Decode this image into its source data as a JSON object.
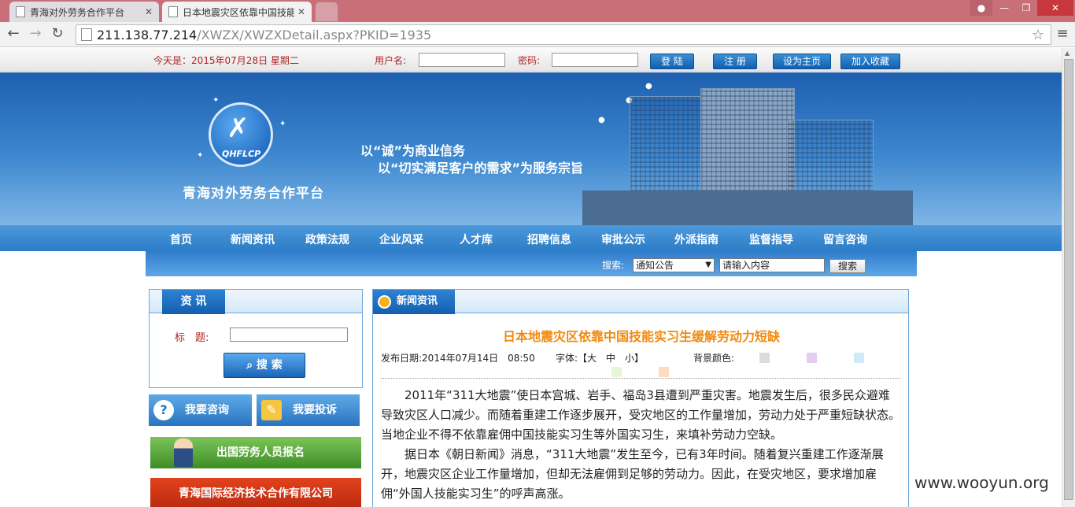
{
  "browser": {
    "tabs": [
      {
        "title": "青海对外劳务合作平台"
      },
      {
        "title": "日本地震灾区依靠中国技能"
      }
    ],
    "url_host": "211.138.77.214",
    "url_path": "/XWZX/XWZXDetail.aspx?PKID=1935"
  },
  "topbar": {
    "date": "今天是：2015年07月28日 星期二",
    "username_label": "用户名:",
    "password_label": "密码:",
    "login": "登 陆",
    "register": "注 册",
    "set_home": "设为主页",
    "favorite": "加入收藏"
  },
  "banner": {
    "logo_abbr": "QHFLCP",
    "site_name": "青海对外劳务合作平台",
    "slogan1": "以“诚”为商业信务",
    "slogan2": "以“切实满足客户的需求”为服务宗旨"
  },
  "nav": [
    "首页",
    "新闻资讯",
    "政策法规",
    "企业风采",
    "人才库",
    "招聘信息",
    "审批公示",
    "外派指南",
    "监督指导",
    "留言咨询"
  ],
  "search": {
    "label": "搜索:",
    "select": "通知公告",
    "input": "请输入内容",
    "button": "搜索"
  },
  "sidebar": {
    "info_title": "资 讯",
    "title_label": "标　题:",
    "search_button": "搜 索",
    "consult": "我要咨询",
    "complain": "我要投诉",
    "register": "出国劳务人员报名",
    "company": "青海国际经济技术合作有限公司"
  },
  "article": {
    "section": "新闻资讯",
    "title": "日本地震灾区依靠中国技能实习生缓解劳动力短缺",
    "publish": "发布日期:2014年07月14日　08:50",
    "font": "字体:【大　中　小】",
    "bg_label": "背景颜色:",
    "bg_colors": [
      "#dcdcdc",
      "#e4ccf2",
      "#cfecf6",
      "#e6f6d6",
      "#fcdcbc"
    ],
    "paragraphs": [
      "2011年“311大地震”使日本宫城、岩手、福岛3县遭到严重灾害。地震发生后，很多民众避难导致灾区人口减少。而随着重建工作逐步展开，受灾地区的工作量增加，劳动力处于严重短缺状态。当地企业不得不依靠雇佣中国技能实习生等外国实习生，来填补劳动力空缺。",
      "据日本《朝日新闻》消息，“311大地震”发生至今，已有3年时间。随着复兴重建工作逐渐展开，地震灾区企业工作量增加，但却无法雇佣到足够的劳动力。因此，在受灾地区，要求增加雇佣“外国人技能实习生”的呼声高涨。"
    ]
  },
  "watermark": "www.wooyun.org"
}
